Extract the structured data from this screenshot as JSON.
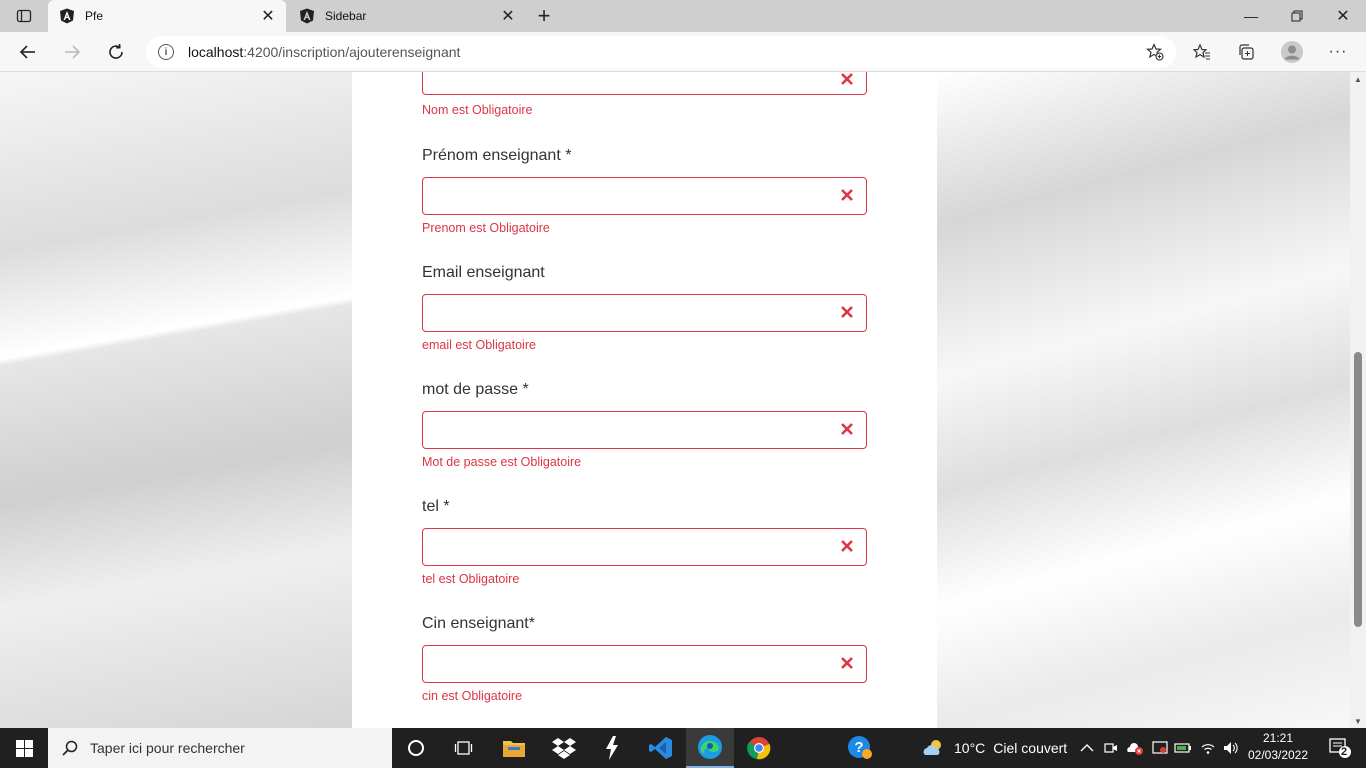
{
  "browser": {
    "tabs": [
      {
        "title": "Pfe",
        "favicon": "angular-icon",
        "active": true
      },
      {
        "title": "Sidebar",
        "favicon": "angular-icon",
        "active": false
      }
    ],
    "address": {
      "host": "localhost",
      "path": ":4200/inscription/ajouterenseignant"
    }
  },
  "form": {
    "fields": [
      {
        "label": "",
        "error": "Nom est Obligatoire"
      },
      {
        "label": "Prénom enseignant *",
        "error": "Prenom est Obligatoire"
      },
      {
        "label": "Email enseignant",
        "error": "email est Obligatoire"
      },
      {
        "label": "mot de passe *",
        "error": "Mot de passe est Obligatoire"
      },
      {
        "label": "tel *",
        "error": "tel est Obligatoire"
      },
      {
        "label": "Cin enseignant*",
        "error": "cin est Obligatoire"
      }
    ]
  },
  "taskbar": {
    "search_placeholder": "Taper ici pour rechercher",
    "weather": {
      "temp": "10°C",
      "desc": "Ciel couvert"
    },
    "clock": {
      "time": "21:21",
      "date": "02/03/2022"
    },
    "notifications": "2"
  },
  "colors": {
    "error": "#dc3545",
    "taskbar": "#202020"
  }
}
